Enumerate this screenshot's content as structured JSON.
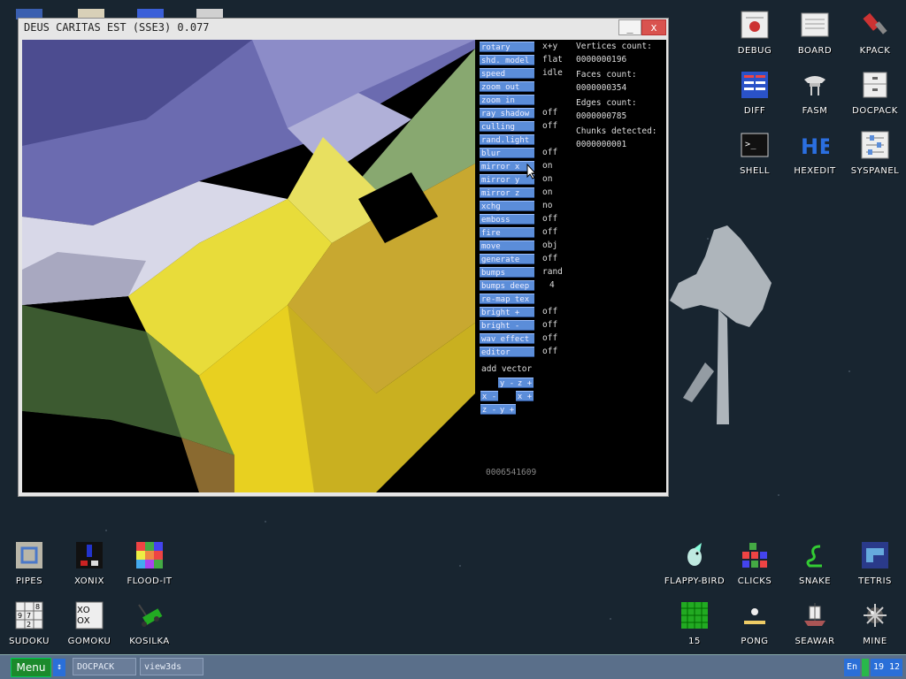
{
  "window": {
    "title": "DEUS CARITAS EST (SSE3) 0.077",
    "min_label": "_",
    "close_label": "x"
  },
  "controls": [
    {
      "label": "rotary",
      "value": "x+y"
    },
    {
      "label": "shd. model",
      "value": "flat"
    },
    {
      "label": "speed",
      "value": "idle"
    },
    {
      "label": "zoom out",
      "value": ""
    },
    {
      "label": "zoom in",
      "value": ""
    },
    {
      "label": "ray shadow",
      "value": "off"
    },
    {
      "label": "culling",
      "value": "off"
    },
    {
      "label": "rand.light",
      "value": ""
    },
    {
      "label": "blur",
      "value": "off"
    },
    {
      "label": "mirror x",
      "value": "on"
    },
    {
      "label": "mirror y",
      "value": "on"
    },
    {
      "label": "mirror z",
      "value": "on"
    },
    {
      "label": "xchg",
      "value": "no"
    },
    {
      "label": "emboss",
      "value": "off"
    },
    {
      "label": "fire",
      "value": "off"
    },
    {
      "label": "move",
      "value": "obj"
    },
    {
      "label": "generate",
      "value": "off"
    },
    {
      "label": "bumps",
      "value": "rand"
    },
    {
      "label": "bumps deep",
      "value": "4"
    },
    {
      "label": "re-map tex",
      "value": ""
    },
    {
      "label": "bright +",
      "value": "off"
    },
    {
      "label": "bright -",
      "value": "off"
    },
    {
      "label": "wav effect",
      "value": "off"
    },
    {
      "label": "editor",
      "value": "off"
    }
  ],
  "stats": [
    {
      "label": "Vertices count:",
      "value": "0000000196"
    },
    {
      "label": "Faces count:",
      "value": "0000000354"
    },
    {
      "label": "Edges count:",
      "value": "0000000785"
    },
    {
      "label": "Chunks detected:",
      "value": "0000000001"
    }
  ],
  "add_vector": {
    "label": "add vector",
    "buttons": [
      "y -",
      "z +",
      "x -",
      "x +",
      "z -",
      "y +"
    ]
  },
  "counter": "0006541609",
  "desktop_icons": [
    {
      "label": "DEBUG",
      "icon": "debug-icon"
    },
    {
      "label": "BOARD",
      "icon": "board-icon"
    },
    {
      "label": "KPACK",
      "icon": "kpack-icon"
    },
    {
      "label": "DIFF",
      "icon": "diff-icon"
    },
    {
      "label": "FASM",
      "icon": "fasm-icon"
    },
    {
      "label": "DOCPACK",
      "icon": "docpack-icon"
    },
    {
      "label": "SHELL",
      "icon": "shell-icon"
    },
    {
      "label": "HEXEDIT",
      "icon": "hexedit-icon"
    },
    {
      "label": "SYSPANEL",
      "icon": "syspanel-icon"
    },
    {
      "label": "PIPES",
      "icon": "pipes-icon"
    },
    {
      "label": "XONIX",
      "icon": "xonix-icon"
    },
    {
      "label": "FLOOD-IT",
      "icon": "flood-it-icon"
    },
    {
      "label": "SUDOKU",
      "icon": "sudoku-icon"
    },
    {
      "label": "GOMOKU",
      "icon": "gomoku-icon"
    },
    {
      "label": "KOSILKA",
      "icon": "kosilka-icon"
    },
    {
      "label": "FLAPPY-BIRD",
      "icon": "flappy-bird-icon"
    },
    {
      "label": "CLICKS",
      "icon": "clicks-icon"
    },
    {
      "label": "SNAKE",
      "icon": "snake-icon"
    },
    {
      "label": "TETRIS",
      "icon": "tetris-icon"
    },
    {
      "label": "15",
      "icon": "fifteen-icon"
    },
    {
      "label": "PONG",
      "icon": "pong-icon"
    },
    {
      "label": "SEAWAR",
      "icon": "seawar-icon"
    },
    {
      "label": "MINE",
      "icon": "mine-icon"
    }
  ],
  "taskbar": {
    "menu_label": "Menu",
    "switch_label": "↕",
    "tasks": [
      "DOCPACK",
      "view3ds"
    ],
    "lang": "En",
    "clock": "19 12"
  },
  "colors": {
    "desktop_bg": "#182530",
    "button_blue": "#5b8dd9",
    "taskbar_bg": "#5a6f8a",
    "menu_green": "#1c8a2c"
  }
}
